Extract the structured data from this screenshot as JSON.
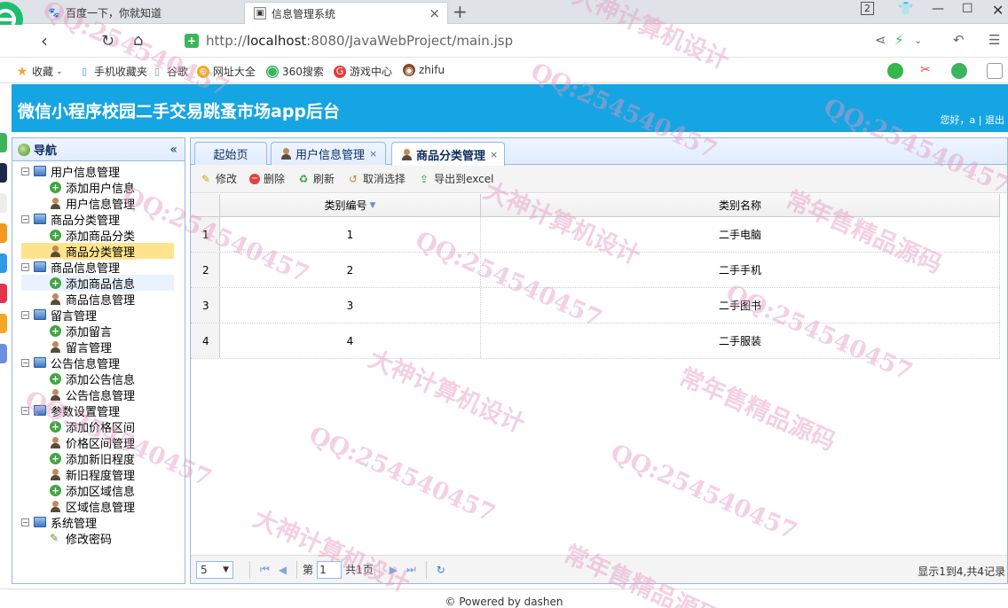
{
  "browser": {
    "tabs": [
      {
        "title": "百度一下，你就知道"
      },
      {
        "title": "信息管理系统"
      }
    ],
    "url_prefix": "http://",
    "url_host": "localhost",
    "url_rest": ":8080/JavaWebProject/main.jsp",
    "tab_count": "2",
    "bookmarks": [
      "收藏",
      "手机收藏夹",
      "谷歌",
      "网址大全",
      "360搜索",
      "游戏中心",
      "zhifu"
    ]
  },
  "app": {
    "title": "微信小程序校园二手交易跳蚤市场app后台",
    "greeting": "您好，a",
    "logout": "退出",
    "separator": "|"
  },
  "nav": {
    "title": "导航",
    "collapse_glyph": "«",
    "groups": [
      {
        "label": "用户信息管理",
        "children": [
          "添加用户信息",
          "用户信息管理"
        ]
      },
      {
        "label": "商品分类管理",
        "children": [
          "添加商品分类",
          "商品分类管理"
        ]
      },
      {
        "label": "商品信息管理",
        "children": [
          "添加商品信息",
          "商品信息管理"
        ]
      },
      {
        "label": "留言管理",
        "children": [
          "添加留言",
          "留言管理"
        ]
      },
      {
        "label": "公告信息管理",
        "children": [
          "添加公告信息",
          "公告信息管理"
        ]
      },
      {
        "label": "参数设置管理",
        "children": [
          "添加价格区间",
          "价格区间管理",
          "添加新旧程度",
          "新旧程度管理",
          "添加区域信息",
          "区域信息管理"
        ]
      },
      {
        "label": "系统管理",
        "children": [
          "修改密码"
        ]
      }
    ]
  },
  "content_tabs": [
    {
      "label": "起始页"
    },
    {
      "label": "用户信息管理"
    },
    {
      "label": "商品分类管理"
    }
  ],
  "toolbar": {
    "edit": "修改",
    "delete": "删除",
    "refresh": "刷新",
    "cancel_select": "取消选择",
    "export": "导出到excel"
  },
  "grid": {
    "columns": [
      "类别编号",
      "类别名称"
    ],
    "rows": [
      {
        "num": "1",
        "id": "1",
        "name": "二手电脑"
      },
      {
        "num": "2",
        "id": "2",
        "name": "二手手机"
      },
      {
        "num": "3",
        "id": "3",
        "name": "二手图书"
      },
      {
        "num": "4",
        "id": "4",
        "name": "二手服装"
      }
    ]
  },
  "pager": {
    "page_size": "5",
    "page_label": "第",
    "page_value": "1",
    "total_pages": "共1页",
    "info": "显示1到4,共4记录"
  },
  "footer": {
    "text": "© Powered by dashen"
  },
  "watermarks": [
    "QQ:254540457",
    "大神计算机设计",
    "常年售精品源码"
  ]
}
